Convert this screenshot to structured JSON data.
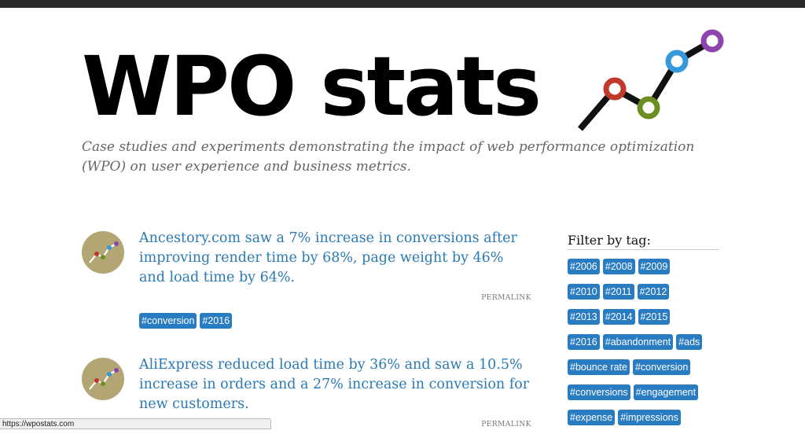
{
  "site": {
    "title": "WPO stats",
    "tagline": "Case studies and experiments demonstrating the impact of web performance optimization (WPO) on user experience and business metrics."
  },
  "posts": [
    {
      "title": "Ancestory.com saw a 7% increase in conversions after improving render time by 68%, page weight by 46% and load time by 64%.",
      "permalink": "PERMALINK",
      "tags": [
        "#conversion",
        "#2016"
      ]
    },
    {
      "title": "AliExpress reduced load time by 36% and saw a 10.5% increase in orders and a 27% increase in conversion for new customers.",
      "permalink": "PERMALINK",
      "tags": []
    }
  ],
  "sidebar": {
    "heading": "Filter by tag:",
    "tags": [
      "#2006",
      "#2008",
      "#2009",
      "#2010",
      "#2011",
      "#2012",
      "#2013",
      "#2014",
      "#2015",
      "#2016",
      "#abandonment",
      "#ads",
      "#bounce rate",
      "#conversion",
      "#conversions",
      "#engagement",
      "#expense",
      "#impressions"
    ]
  },
  "status_bar": {
    "url": "https://wpostats.com"
  },
  "logo_colors": {
    "line": "#111111",
    "red": "#c0392b",
    "green": "#6b8e23",
    "blue": "#3498db",
    "purple": "#8e44ad",
    "avatar_bg": "#b3a574"
  }
}
